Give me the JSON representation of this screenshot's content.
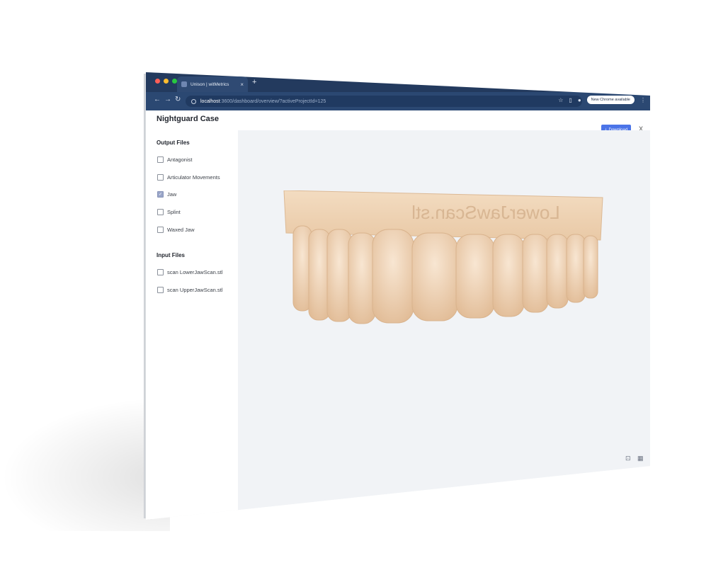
{
  "browser": {
    "tab_title": "Unison | witMetrics",
    "tab_close": "×",
    "new_tab": "+",
    "url_host": "localhost",
    "url_path": ":3600/dashboard/overview/?activeProjectId=125",
    "nav": {
      "back": "←",
      "forward": "→",
      "reload": "↻"
    },
    "update_text": "New Chrome available",
    "dot_colors": [
      "#ff5f57",
      "#febc2e",
      "#28c840"
    ]
  },
  "header": {
    "title": "Nightguard Case",
    "download_label": "Download",
    "close_label": "X"
  },
  "sidebar": {
    "output_title": "Output Files",
    "output_files": [
      {
        "label": "Antagonist",
        "checked": false
      },
      {
        "label": "Articulator Movements",
        "checked": false
      },
      {
        "label": "Jaw",
        "checked": true
      },
      {
        "label": "Splint",
        "checked": false
      },
      {
        "label": "Waxed Jaw",
        "checked": false
      }
    ],
    "input_title": "Input Files",
    "input_files": [
      {
        "label": "scan LowerJawScan.stl",
        "checked": false
      },
      {
        "label": "scan UpperJawScan.stl",
        "checked": false
      }
    ]
  },
  "viewport": {
    "model_engraving": "LowerJawScan.stl",
    "model_color": "#f1d6b9",
    "controls": [
      "focus-icon",
      "grid-icon"
    ]
  },
  "accent_color": "#4b74e8"
}
